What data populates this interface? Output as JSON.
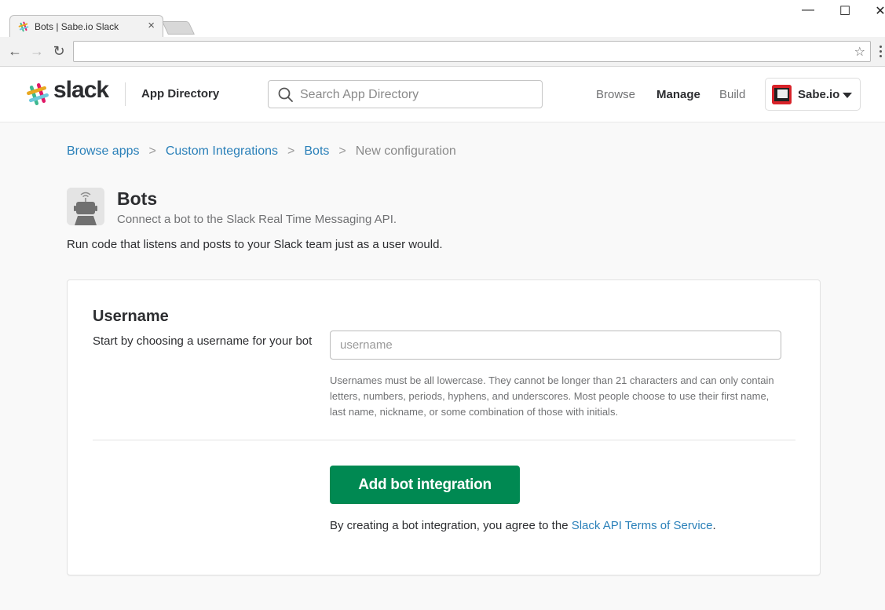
{
  "browser": {
    "tab_title": "Bots | Sabe.io Slack",
    "tab_close": "×",
    "minimize": "—",
    "maximize": "☐",
    "close": "✕",
    "back": "←",
    "forward": "→",
    "reload": "↻",
    "address": "",
    "star": "☆"
  },
  "header": {
    "wordmark": "slack",
    "section": "App Directory",
    "search_placeholder": "Search App Directory",
    "nav": [
      {
        "label": "Browse"
      },
      {
        "label": "Manage"
      },
      {
        "label": "Build"
      }
    ],
    "team_name": "Sabe.io"
  },
  "breadcrumb": {
    "items": [
      {
        "label": "Browse apps"
      },
      {
        "label": "Custom Integrations"
      },
      {
        "label": "Bots"
      }
    ],
    "current": "New configuration",
    "separator": ">"
  },
  "app": {
    "name": "Bots",
    "subtitle": "Connect a bot to the Slack Real Time Messaging API.",
    "description": "Run code that listens and posts to your Slack team just as a user would."
  },
  "form": {
    "section_title": "Username",
    "section_help": "Start by choosing a username for your bot",
    "username_placeholder": "username",
    "username_value": "",
    "hint": "Usernames must be all lowercase. They cannot be longer than 21 characters and can only contain letters, numbers, periods, hyphens, and underscores. Most people choose to use their first name, last name, nickname, or some combination of those with initials.",
    "submit_label": "Add bot integration",
    "terms_prefix": "By creating a bot integration, you agree to the ",
    "terms_link": "Slack API Terms of Service",
    "terms_suffix": "."
  },
  "colors": {
    "primary_button": "#008952",
    "link": "#2a80b9"
  }
}
